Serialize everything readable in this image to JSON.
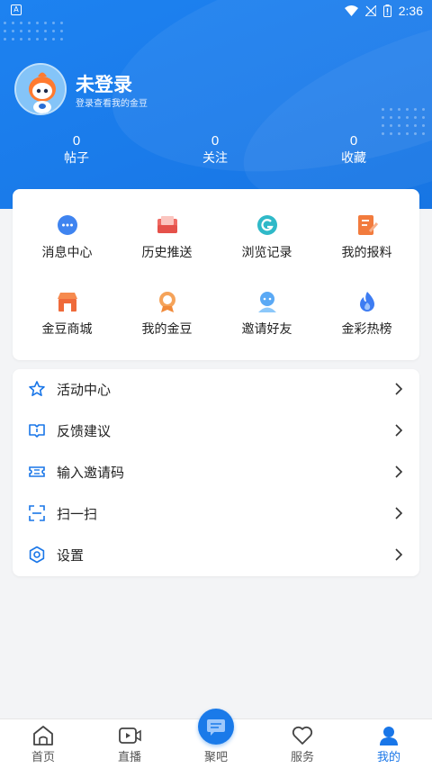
{
  "status_bar": {
    "time": "2:36",
    "left_badge": "A"
  },
  "profile": {
    "name": "未登录",
    "subtitle": "登录查看我的金豆"
  },
  "stats": [
    {
      "value": "0",
      "label": "帖子"
    },
    {
      "value": "0",
      "label": "关注"
    },
    {
      "value": "0",
      "label": "收藏"
    }
  ],
  "quick_grid": [
    {
      "label": "消息中心",
      "icon": "message-icon"
    },
    {
      "label": "历史推送",
      "icon": "mailbox-icon"
    },
    {
      "label": "浏览记录",
      "icon": "history-icon"
    },
    {
      "label": "我的报料",
      "icon": "edit-note-icon"
    },
    {
      "label": "金豆商城",
      "icon": "shop-icon"
    },
    {
      "label": "我的金豆",
      "icon": "medal-icon"
    },
    {
      "label": "邀请好友",
      "icon": "invite-icon"
    },
    {
      "label": "金彩热榜",
      "icon": "flame-icon"
    }
  ],
  "menu": [
    {
      "label": "活动中心",
      "icon": "star-icon"
    },
    {
      "label": "反馈建议",
      "icon": "feedback-icon"
    },
    {
      "label": "输入邀请码",
      "icon": "ticket-icon"
    },
    {
      "label": "扫一扫",
      "icon": "scan-icon"
    },
    {
      "label": "设置",
      "icon": "settings-icon"
    }
  ],
  "tabs": [
    {
      "label": "首页",
      "icon": "home-icon"
    },
    {
      "label": "直播",
      "icon": "live-icon"
    },
    {
      "label": "聚吧",
      "icon": "chat-icon"
    },
    {
      "label": "服务",
      "icon": "heart-icon"
    },
    {
      "label": "我的",
      "icon": "user-icon"
    }
  ],
  "colors": {
    "accent": "#1976e8",
    "header_bg": "#1a7bea",
    "page_bg": "#f3f4f6"
  }
}
